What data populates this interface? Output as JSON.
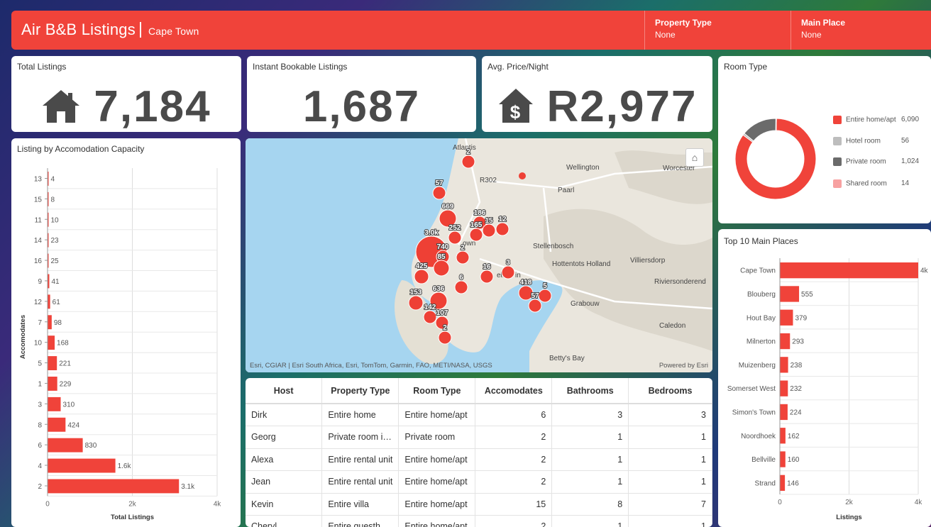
{
  "header": {
    "title": "Air B&B Listings",
    "subtitle": "Cape Town",
    "filters": [
      {
        "label": "Property Type",
        "value": "None"
      },
      {
        "label": "Main Place",
        "value": "None"
      }
    ]
  },
  "kpis": {
    "total": {
      "label": "Total Listings",
      "value": "7,184"
    },
    "instant": {
      "label": "Instant Bookable Listings",
      "value": "1,687"
    },
    "price": {
      "label": "Avg. Price/Night",
      "value": "R2,977"
    }
  },
  "capacity_chart": {
    "title": "Listing by Accomodation Capacity",
    "ylabel": "Accomodates",
    "xlabel": "Total Listings",
    "xticks": [
      "0",
      "2k",
      "4k"
    ]
  },
  "room_type": {
    "title": "Room Type",
    "items": [
      {
        "label": "Entire home/apt",
        "value": "6,090",
        "color": "#f0433a"
      },
      {
        "label": "Hotel room",
        "value": "56",
        "color": "#bdbdbd"
      },
      {
        "label": "Private room",
        "value": "1,024",
        "color": "#6b6b6b"
      },
      {
        "label": "Shared room",
        "value": "14",
        "color": "#f7a1a1"
      }
    ]
  },
  "top_places": {
    "title": "Top 10 Main Places",
    "xlabel": "Listings",
    "xticks": [
      "0",
      "2k",
      "4k"
    ]
  },
  "map": {
    "attribution": "Esri, CGIAR | Esri South Africa, Esri, TomTom, Garmin, FAO, METI/NASA, USGS",
    "powered": "Powered by Esri",
    "places": [
      "Atlantis",
      "Wellington",
      "Worcester",
      "Paarl",
      "Stellenbosch",
      "Villiersdorp",
      "Hottentots Holland",
      "Grabouw",
      "Caledon",
      "Riviersonderend",
      "Betty's Bay",
      "R302",
      "own",
      "ell",
      "in"
    ],
    "cluster_labels": [
      "2",
      "57",
      "669",
      "186",
      "12",
      "165",
      "15",
      "3.0k",
      "252",
      "2",
      "740",
      "425",
      "85",
      "16",
      "3",
      "6",
      "418",
      "5",
      "636",
      "153",
      "57",
      "142",
      "107",
      "2"
    ]
  },
  "table": {
    "columns": [
      "Host",
      "Property Type",
      "Room Type",
      "Accomodates",
      "Bathrooms",
      "Bedrooms"
    ],
    "rows": [
      [
        "Dirk",
        "Entire home",
        "Entire home/apt",
        "6",
        "3",
        "3"
      ],
      [
        "Georg",
        "Private room i…",
        "Private room",
        "2",
        "1",
        "1"
      ],
      [
        "Alexa",
        "Entire rental unit",
        "Entire home/apt",
        "2",
        "1",
        "1"
      ],
      [
        "Jean",
        "Entire rental unit",
        "Entire home/apt",
        "2",
        "1",
        "1"
      ],
      [
        "Kevin",
        "Entire villa",
        "Entire home/apt",
        "15",
        "8",
        "7"
      ],
      [
        "Cheryl",
        "Entire guesth…",
        "Entire home/apt",
        "2",
        "1",
        "1"
      ]
    ]
  },
  "chart_data": [
    {
      "type": "bar",
      "title": "Listing by Accomodation Capacity",
      "xlabel": "Total Listings",
      "ylabel": "Accomodates",
      "xlim": [
        0,
        4000
      ],
      "orientation": "horizontal",
      "categories": [
        "13",
        "15",
        "11",
        "14",
        "16",
        "9",
        "12",
        "7",
        "10",
        "5",
        "1",
        "3",
        "8",
        "6",
        "4",
        "2"
      ],
      "values": [
        4,
        8,
        10,
        23,
        25,
        41,
        61,
        98,
        168,
        221,
        229,
        310,
        424,
        830,
        1600,
        3100
      ],
      "labels": [
        "4",
        "8",
        "10",
        "23",
        "25",
        "41",
        "61",
        "98",
        "168",
        "221",
        "229",
        "310",
        "424",
        "830",
        "1.6k",
        "3.1k"
      ],
      "color": "#f0433a"
    },
    {
      "type": "pie",
      "title": "Room Type",
      "categories": [
        "Entire home/apt",
        "Hotel room",
        "Private room",
        "Shared room"
      ],
      "values": [
        6090,
        56,
        1024,
        14
      ],
      "colors": [
        "#f0433a",
        "#bdbdbd",
        "#6b6b6b",
        "#f7a1a1"
      ]
    },
    {
      "type": "bar",
      "title": "Top 10 Main Places",
      "xlabel": "Listings",
      "xlim": [
        0,
        4000
      ],
      "orientation": "horizontal",
      "categories": [
        "Cape Town",
        "Blouberg",
        "Hout Bay",
        "Milnerton",
        "Muizenberg",
        "Somerset West",
        "Simon's Town",
        "Noordhoek",
        "Bellville",
        "Strand"
      ],
      "values": [
        4000,
        555,
        379,
        293,
        238,
        232,
        224,
        162,
        160,
        146
      ],
      "labels": [
        "4k",
        "555",
        "379",
        "293",
        "238",
        "232",
        "224",
        "162",
        "160",
        "146"
      ],
      "color": "#f0433a"
    }
  ]
}
